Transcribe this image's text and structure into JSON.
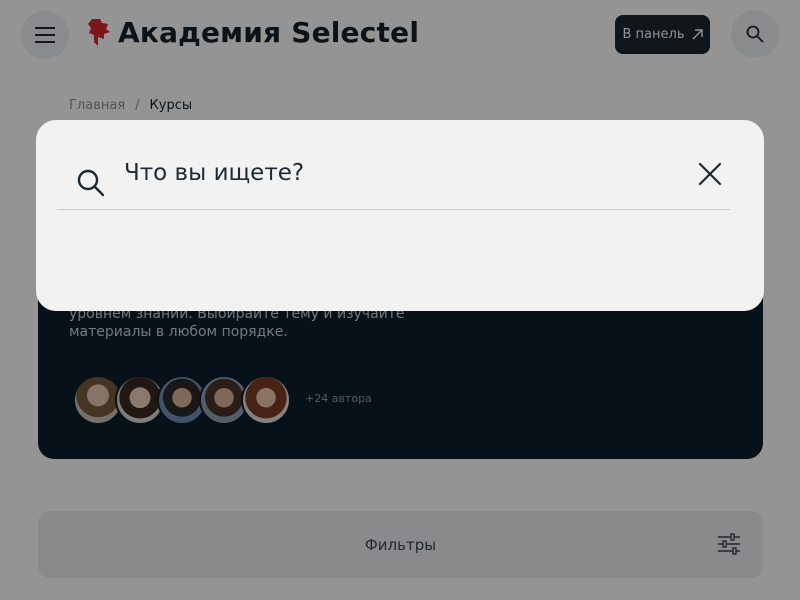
{
  "header": {
    "brand": "Академия Selectel",
    "panel_button": "В панель",
    "brand_color": "#d7262c",
    "icons": [
      "menu-icon",
      "selectel-logo-icon",
      "arrow-up-right-icon",
      "search-icon"
    ]
  },
  "breadcrumb": {
    "items": [
      "Главная",
      "Курсы"
    ],
    "separator": "/"
  },
  "hero": {
    "description": "уровнем знаний. Выбирайте тему и изучайте материалы в любом порядке.",
    "authors_more": "+24 автора"
  },
  "filters": {
    "label": "Фильтры",
    "icon": "sliders-icon"
  },
  "search_modal": {
    "placeholder": "Что вы ищете?",
    "value": "",
    "icons": [
      "search-icon",
      "close-icon"
    ]
  }
}
